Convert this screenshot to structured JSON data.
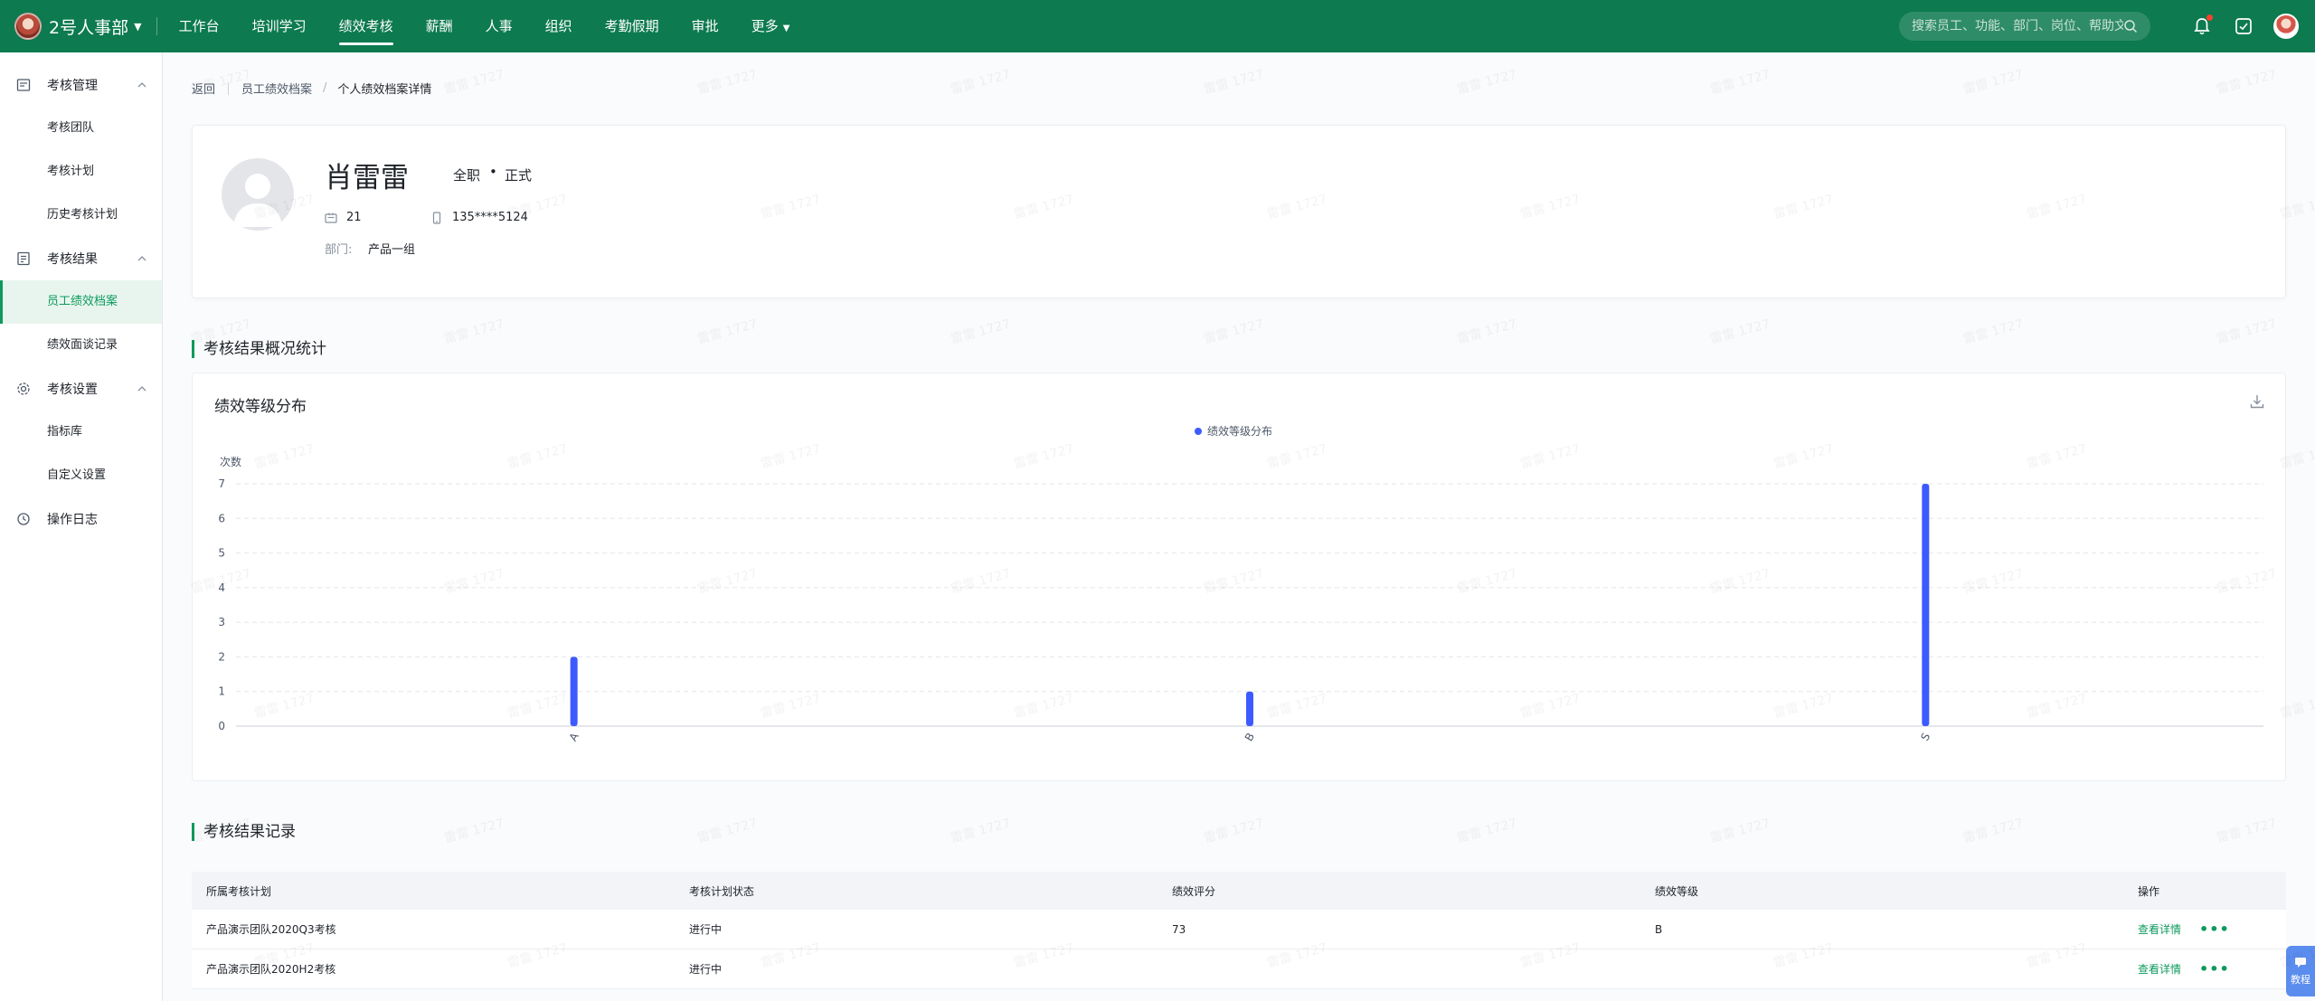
{
  "topbar": {
    "org_name": "2号人事部",
    "nav": [
      {
        "label": "工作台"
      },
      {
        "label": "培训学习"
      },
      {
        "label": "绩效考核",
        "active": true
      },
      {
        "label": "薪酬"
      },
      {
        "label": "人事"
      },
      {
        "label": "组织"
      },
      {
        "label": "考勤假期"
      },
      {
        "label": "审批"
      },
      {
        "label": "更多"
      }
    ],
    "search_placeholder": "搜索员工、功能、部门、岗位、帮助文档",
    "icons": [
      "bell-icon",
      "approval-check-icon",
      "user-avatar"
    ],
    "accent": "#0d7a50"
  },
  "sidebar": {
    "groups": [
      {
        "label": "考核管理",
        "icon": "assessment-icon",
        "items": [
          "考核团队",
          "考核计划",
          "历史考核计划"
        ]
      },
      {
        "label": "考核结果",
        "icon": "result-icon",
        "items": [
          "员工绩效档案",
          "绩效面谈记录"
        ]
      },
      {
        "label": "考核设置",
        "icon": "settings-icon",
        "items": [
          "指标库",
          "自定义设置"
        ]
      },
      {
        "label": "操作日志",
        "icon": "clock-icon",
        "items": []
      }
    ],
    "active_item": "员工绩效档案",
    "active_color": "#0d9a5c"
  },
  "breadcrumb": {
    "back": "返回",
    "parent": "员工绩效档案",
    "current": "个人绩效档案详情"
  },
  "profile": {
    "name": "肖雷雷",
    "employment_type": "全职",
    "dot": "•",
    "status": "正式",
    "employee_no": "21",
    "phone": "135****5124",
    "dept_label": "部门:",
    "dept_value": "产品一组"
  },
  "sections": {
    "overview_title": "考核结果概况统计",
    "records_title": "考核结果记录"
  },
  "chart_data": {
    "type": "bar",
    "title": "绩效等级分布",
    "legend": [
      "绩效等级分布"
    ],
    "legend_position": "top-center",
    "ylabel": "次数",
    "xlabel": "",
    "categories": [
      "A",
      "B",
      "S"
    ],
    "series": [
      {
        "name": "绩效等级分布",
        "values": [
          2,
          1,
          7
        ],
        "color": "#3d5afe"
      }
    ],
    "ylim": [
      0,
      7
    ],
    "yticks": [
      0,
      1,
      2,
      3,
      4,
      5,
      6,
      7
    ],
    "grid": true
  },
  "table": {
    "headers": [
      "所属考核计划",
      "考核计划状态",
      "绩效评分",
      "绩效等级",
      "操作"
    ],
    "rows": [
      {
        "plan": "产品演示团队2020Q3考核",
        "status": "进行中",
        "score": "73",
        "grade": "B",
        "action": "查看详情",
        "more": "•••"
      },
      {
        "plan": "产品演示团队2020H2考核",
        "status": "进行中",
        "score": "",
        "grade": "",
        "action": "查看详情",
        "more": "•••"
      }
    ]
  },
  "help_float": {
    "label": "教程"
  }
}
